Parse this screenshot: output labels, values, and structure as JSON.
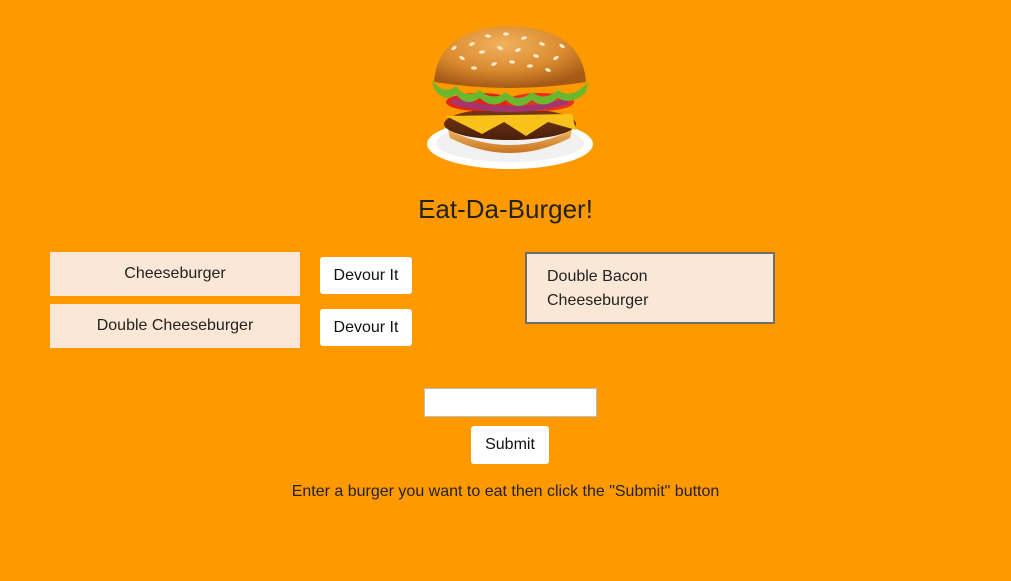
{
  "header": {
    "logo_icon": "hamburger-icon",
    "title": "Eat-Da-Burger!"
  },
  "burgers_to_eat": [
    {
      "name": "Cheeseburger",
      "button_label": "Devour It"
    },
    {
      "name": "Double Cheeseburger",
      "button_label": "Devour It"
    }
  ],
  "devoured_burgers": [
    {
      "name": "Double Bacon Cheeseburger"
    }
  ],
  "form": {
    "input_value": "",
    "input_placeholder": "",
    "submit_label": "Submit",
    "instructions": "Enter a burger you want to eat then click the \"Submit\" button"
  },
  "colors": {
    "background": "#ff9900",
    "item_background": "#fae7d6",
    "button_background": "#ffffff",
    "devoured_border": "#6e6e6e"
  }
}
